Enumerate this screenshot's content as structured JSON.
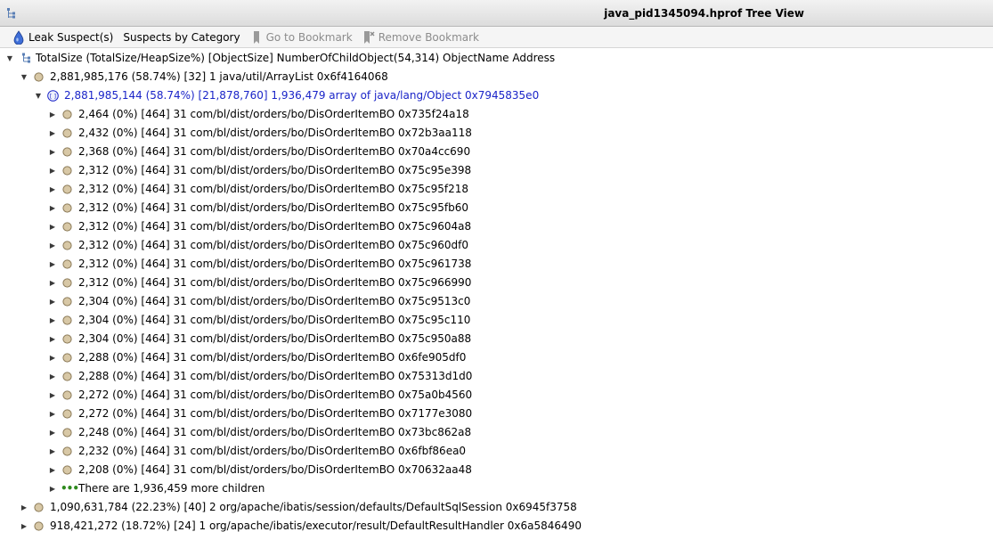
{
  "window": {
    "title": "java_pid1345094.hprof Tree View"
  },
  "toolbar": {
    "leak_suspects": "Leak Suspect(s)",
    "suspects_by_category": "Suspects by Category",
    "go_to_bookmark": "Go to Bookmark",
    "remove_bookmark": "Remove Bookmark"
  },
  "tree": {
    "header": "TotalSize (TotalSize/HeapSize%) [ObjectSize] NumberOfChildObject(54,314) ObjectName Address",
    "arraylist_node": "2,881,985,176 (58.74%) [32] 1 java/util/ArrayList 0x6f4164068",
    "array_node": "2,881,985,144 (58.74%) [21,878,760] 1,936,479 array of java/lang/Object 0x7945835e0",
    "children": [
      "2,464 (0%) [464] 31 com/bl/dist/orders/bo/DisOrderItemBO 0x735f24a18",
      "2,432 (0%) [464] 31 com/bl/dist/orders/bo/DisOrderItemBO 0x72b3aa118",
      "2,368 (0%) [464] 31 com/bl/dist/orders/bo/DisOrderItemBO 0x70a4cc690",
      "2,312 (0%) [464] 31 com/bl/dist/orders/bo/DisOrderItemBO 0x75c95e398",
      "2,312 (0%) [464] 31 com/bl/dist/orders/bo/DisOrderItemBO 0x75c95f218",
      "2,312 (0%) [464] 31 com/bl/dist/orders/bo/DisOrderItemBO 0x75c95fb60",
      "2,312 (0%) [464] 31 com/bl/dist/orders/bo/DisOrderItemBO 0x75c9604a8",
      "2,312 (0%) [464] 31 com/bl/dist/orders/bo/DisOrderItemBO 0x75c960df0",
      "2,312 (0%) [464] 31 com/bl/dist/orders/bo/DisOrderItemBO 0x75c961738",
      "2,312 (0%) [464] 31 com/bl/dist/orders/bo/DisOrderItemBO 0x75c966990",
      "2,304 (0%) [464] 31 com/bl/dist/orders/bo/DisOrderItemBO 0x75c9513c0",
      "2,304 (0%) [464] 31 com/bl/dist/orders/bo/DisOrderItemBO 0x75c95c110",
      "2,304 (0%) [464] 31 com/bl/dist/orders/bo/DisOrderItemBO 0x75c950a88",
      "2,288 (0%) [464] 31 com/bl/dist/orders/bo/DisOrderItemBO 0x6fe905df0",
      "2,288 (0%) [464] 31 com/bl/dist/orders/bo/DisOrderItemBO 0x75313d1d0",
      "2,272 (0%) [464] 31 com/bl/dist/orders/bo/DisOrderItemBO 0x75a0b4560",
      "2,272 (0%) [464] 31 com/bl/dist/orders/bo/DisOrderItemBO 0x7177e3080",
      "2,248 (0%) [464] 31 com/bl/dist/orders/bo/DisOrderItemBO 0x73bc862a8",
      "2,232 (0%) [464] 31 com/bl/dist/orders/bo/DisOrderItemBO 0x6fbf86ea0",
      "2,208 (0%) [464] 31 com/bl/dist/orders/bo/DisOrderItemBO 0x70632aa48"
    ],
    "more_children": "There are 1,936,459 more children",
    "sibling_nodes": [
      "1,090,631,784 (22.23%) [40] 2 org/apache/ibatis/session/defaults/DefaultSqlSession 0x6945f3758",
      "918,421,272 (18.72%) [24] 1 org/apache/ibatis/executor/result/DefaultResultHandler 0x6a5846490"
    ]
  },
  "colors": {
    "selected_text": "#1a24c8",
    "object_icon": "#d8c8a6",
    "more_dots": "#2f8a1e"
  }
}
